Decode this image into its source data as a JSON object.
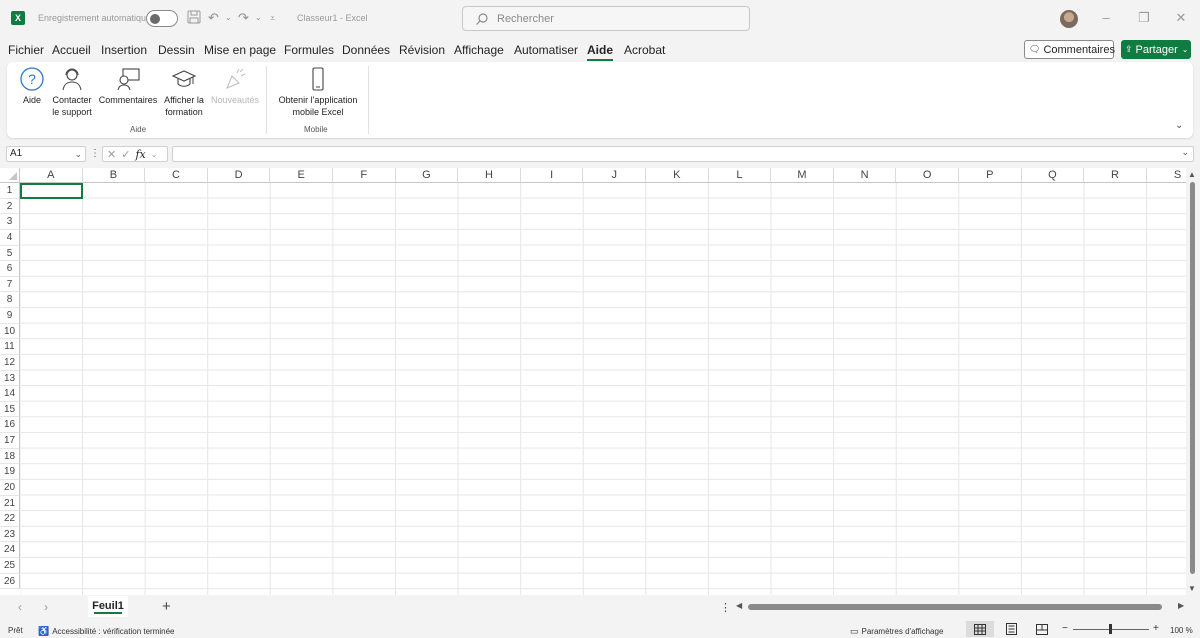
{
  "titlebar": {
    "app_icon": "excel-logo",
    "app_icon_letter": "X",
    "autosave_label": "Enregistrement automatique",
    "doc_title": "Classeur1 - Excel",
    "search_placeholder": "Rechercher",
    "window_controls": {
      "minimize": "–",
      "restore": "❐",
      "close": "✕"
    }
  },
  "menu": {
    "tabs": [
      "Fichier",
      "Accueil",
      "Insertion",
      "Dessin",
      "Mise en page",
      "Formules",
      "Données",
      "Révision",
      "Affichage",
      "Automatiser",
      "Aide",
      "Acrobat"
    ],
    "active_tab": "Aide",
    "comments_label": "Commentaires",
    "share_label": "Partager"
  },
  "ribbon": {
    "groups": [
      {
        "label": "Aide",
        "buttons": [
          {
            "label": "Aide",
            "icon": "help-icon"
          },
          {
            "label": "Contacter le support",
            "icon": "support-icon"
          },
          {
            "label": "Commentaires",
            "icon": "feedback-icon"
          },
          {
            "label": "Afficher la formation",
            "icon": "training-icon"
          },
          {
            "label": "Nouveautés",
            "icon": "whats-new-icon",
            "disabled": true
          }
        ]
      },
      {
        "label": "Mobile",
        "buttons": [
          {
            "label": "Obtenir l'application mobile Excel",
            "icon": "mobile-icon"
          }
        ]
      }
    ]
  },
  "formula_bar": {
    "name_box": "A1",
    "fx": "fx",
    "formula": ""
  },
  "grid": {
    "columns": [
      "A",
      "B",
      "C",
      "D",
      "E",
      "F",
      "G",
      "H",
      "I",
      "J",
      "K",
      "L",
      "M",
      "N",
      "O",
      "P",
      "Q",
      "R",
      "S"
    ],
    "rows": [
      "1",
      "2",
      "3",
      "4",
      "5",
      "6",
      "7",
      "8",
      "9",
      "10",
      "11",
      "12",
      "13",
      "14",
      "15",
      "16",
      "17",
      "18",
      "19",
      "20",
      "21",
      "22",
      "23",
      "24",
      "25",
      "26"
    ],
    "active_cell": "A1"
  },
  "sheets": {
    "tabs": [
      "Feuil1"
    ],
    "active": "Feuil1"
  },
  "status": {
    "ready": "Prêt",
    "accessibility": "Accessibilité : vérification terminée",
    "display_settings": "Paramètres d'affichage",
    "zoom": "100 %"
  },
  "colors": {
    "accent": "#107c41",
    "help_icon": "#2b78c5"
  }
}
